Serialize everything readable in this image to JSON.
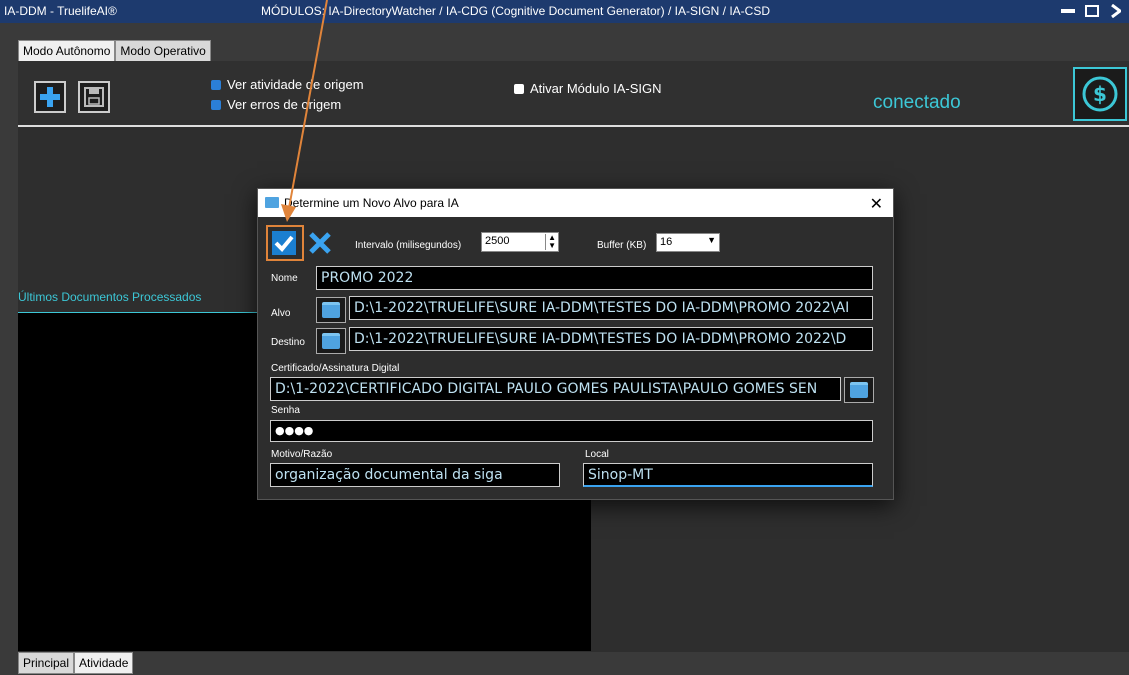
{
  "window": {
    "app_title": "IA-DDM  -  TruelifeAI®",
    "modules_title": "MÓDULOS:  IA-DirectoryWatcher / IA-CDG (Cognitive Document Generator) / IA-SIGN / IA-CSD"
  },
  "tabs_top": [
    "Modo Autônomo",
    "Modo Operativo"
  ],
  "toolbar": {
    "check_activity": "Ver atividade de origem",
    "check_errors": "Ver erros de origem",
    "check_sign": "Ativar Módulo IA-SIGN",
    "status": "conectado"
  },
  "panel": {
    "list_title": "Últimos Documentos Processados"
  },
  "tabs_bottom": [
    "Principal",
    "Atividade"
  ],
  "dialog": {
    "title": "Determine um Novo Alvo para IA",
    "interval_label": "Intervalo (milisegundos)",
    "interval_value": "2500",
    "buffer_label": "Buffer (KB)",
    "buffer_value": "16",
    "nome_label": "Nome",
    "nome_value": "PROMO 2022",
    "alvo_label": "Alvo",
    "alvo_value": "D:\\1-2022\\TRUELIFE\\SURE IA-DDM\\TESTES DO IA-DDM\\PROMO 2022\\AI",
    "destino_label": "Destino",
    "destino_value": "D:\\1-2022\\TRUELIFE\\SURE IA-DDM\\TESTES DO IA-DDM\\PROMO 2022\\D",
    "cert_label": "Certificado/Assinatura Digital",
    "cert_value": "D:\\1-2022\\CERTIFICADO DIGITAL PAULO GOMES PAULISTA\\PAULO GOMES SEN",
    "senha_label": "Senha",
    "senha_value": "●●●●",
    "motivo_label": "Motivo/Razão",
    "motivo_value": "organização documental da siga",
    "local_label": "Local",
    "local_value": "Sinop-MT"
  }
}
